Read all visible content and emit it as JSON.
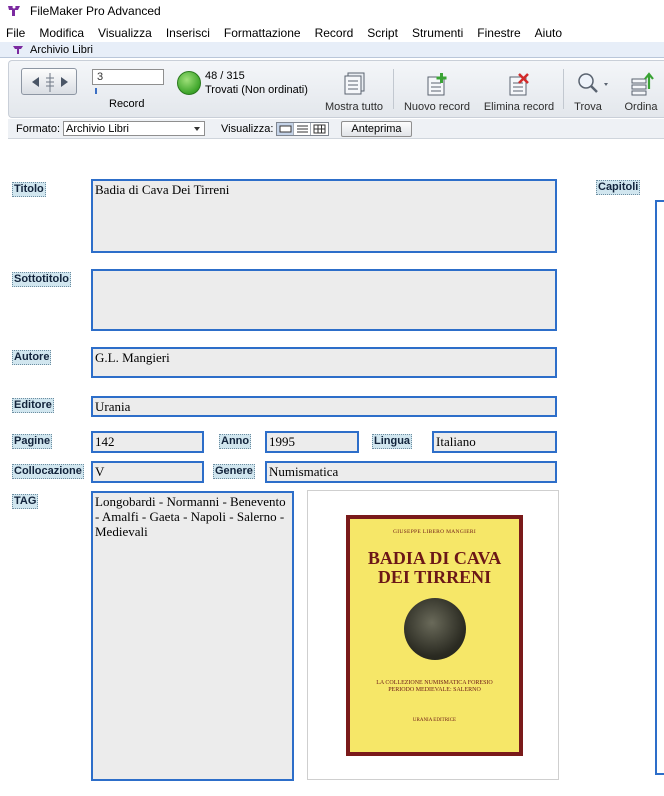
{
  "app": {
    "title": "FileMaker Pro Advanced"
  },
  "menu": [
    "File",
    "Modifica",
    "Visualizza",
    "Inserisci",
    "Formattazione",
    "Record",
    "Script",
    "Strumenti",
    "Finestre",
    "Aiuto"
  ],
  "window": {
    "title": "Archivio Libri"
  },
  "toolbar": {
    "record_number": "3",
    "record_label": "Record",
    "found_count": "48 / 315",
    "found_status": "Trovati (Non ordinati)",
    "show_all": "Mostra tutto",
    "new_record": "Nuovo record",
    "delete_record": "Elimina record",
    "find": "Trova",
    "sort": "Ordina"
  },
  "layoutbar": {
    "format_label": "Formato:",
    "layout": "Archivio Libri",
    "view_label": "Visualizza:",
    "preview": "Anteprima"
  },
  "labels": {
    "titolo": "Titolo",
    "sottotitolo": "Sottotitolo",
    "autore": "Autore",
    "editore": "Editore",
    "pagine": "Pagine",
    "anno": "Anno",
    "lingua": "Lingua",
    "collocazione": "Collocazione",
    "genere": "Genere",
    "tag": "TAG",
    "capitoli": "Capitoli"
  },
  "record": {
    "titolo": "Badia di Cava Dei Tirreni",
    "sottotitolo": "",
    "autore": "G.L. Mangieri",
    "editore": "Urania",
    "pagine": "142",
    "anno": "1995",
    "lingua": "Italiano",
    "collocazione": "V",
    "genere": "Numismatica",
    "tag": "Longobardi - Normanni - Benevento - Amalfi - Gaeta - Napoli - Salerno - Medievali"
  },
  "cover": {
    "author": "GIUSEPPE LIBERO MANGIERI",
    "title_line1": "BADIA DI CAVA",
    "title_line2": "DEI TIRRENI",
    "subtitle_line1": "LA COLLEZIONE NUMISMATICA FORESIO",
    "subtitle_line2": "PERIODO MEDIEVALE: SALERNO",
    "publisher": "URANIA EDITRICE"
  },
  "colors": {
    "field_border": "#2d6ec9",
    "field_bg": "#ececec",
    "label_bg": "#d1e6ef"
  }
}
